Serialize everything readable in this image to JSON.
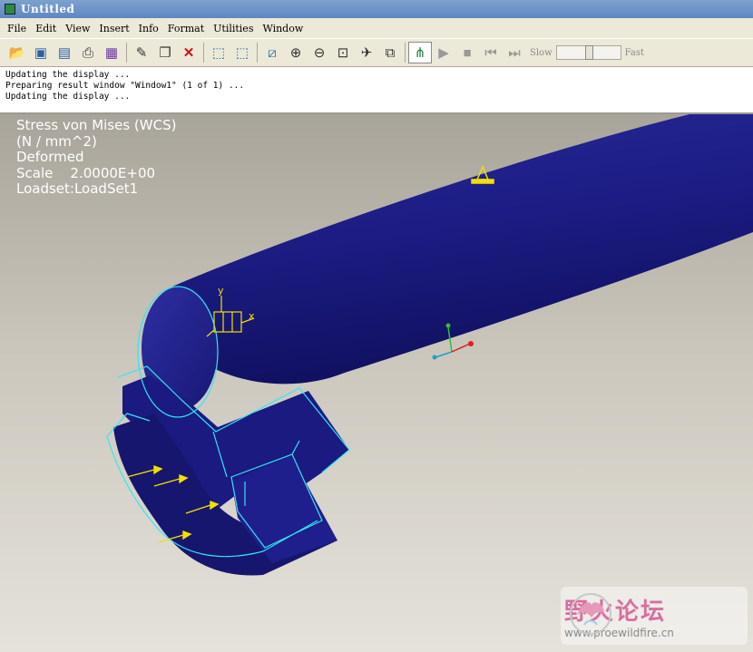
{
  "window": {
    "title": "Untitled"
  },
  "menu": [
    "File",
    "Edit",
    "View",
    "Insert",
    "Info",
    "Format",
    "Utilities",
    "Window"
  ],
  "toolbar": {
    "icons": [
      "open-icon",
      "save-icon",
      "save-as-icon",
      "print-icon",
      "display-icon",
      "edit-icon",
      "copy-icon",
      "delete-icon",
      "reorient-icon",
      "repaint-icon",
      "zoom-fit-icon",
      "zoom-in-icon",
      "zoom-out-icon",
      "zoom-window-icon",
      "spin-icon",
      "view-options-icon",
      "model-tree-icon",
      "play-icon",
      "stop-icon",
      "step-back-icon",
      "step-forward-icon"
    ],
    "speed_slow": "Slow",
    "speed_fast": "Fast",
    "speed_level": 0.5
  },
  "messages": [
    "Updating the display ...",
    "Preparing result window \"Window1\" (1 of 1) ...",
    "Updating the display ..."
  ],
  "legend": {
    "line1": "Stress von Mises (WCS)",
    "line2": "(N / mm^2)",
    "line3": "Deformed",
    "line4": "Scale    2.0000E+00",
    "line5": "Loadset:LoadSet1"
  },
  "colors": {
    "model": "#1a1a80",
    "wireframe": "#33e6f0",
    "load_arrow": "#f2e000"
  },
  "watermark": {
    "chinese": "野火论坛",
    "url": "www.proewildfire.cn"
  }
}
